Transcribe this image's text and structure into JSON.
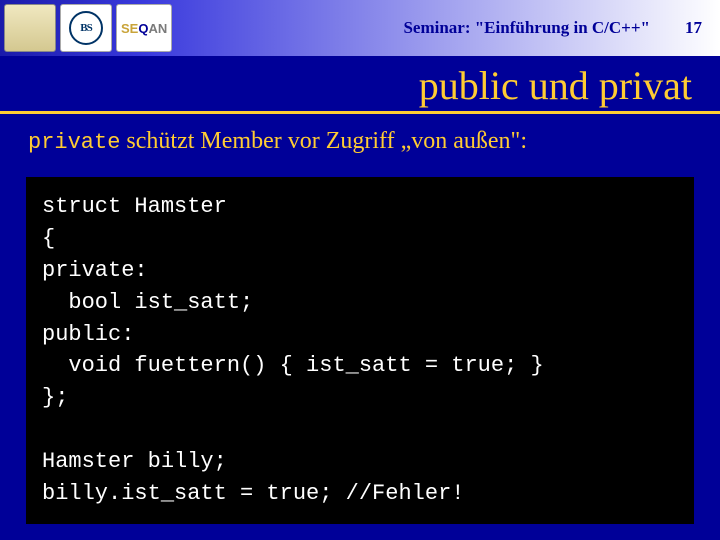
{
  "header": {
    "seminar": "Seminar: \"Einführung in C/C++\"",
    "page": "17",
    "logo3_se": "SE",
    "logo3_q": "Q",
    "logo3_an": "AN",
    "logo2_text": "BS"
  },
  "title": "public und privat",
  "intro": {
    "keyword": "private",
    "rest": " schützt Member vor Zugriff „von außen\":"
  },
  "code": {
    "l1": "struct Hamster",
    "l2": "{",
    "l3": "private:",
    "l4": "  bool ist_satt;",
    "l5": "public:",
    "l6": "  void fuettern() { ist_satt = true; }",
    "l7": "};",
    "l8": "",
    "l9": "Hamster billy;",
    "l10": "billy.ist_satt = true; //Fehler!"
  }
}
